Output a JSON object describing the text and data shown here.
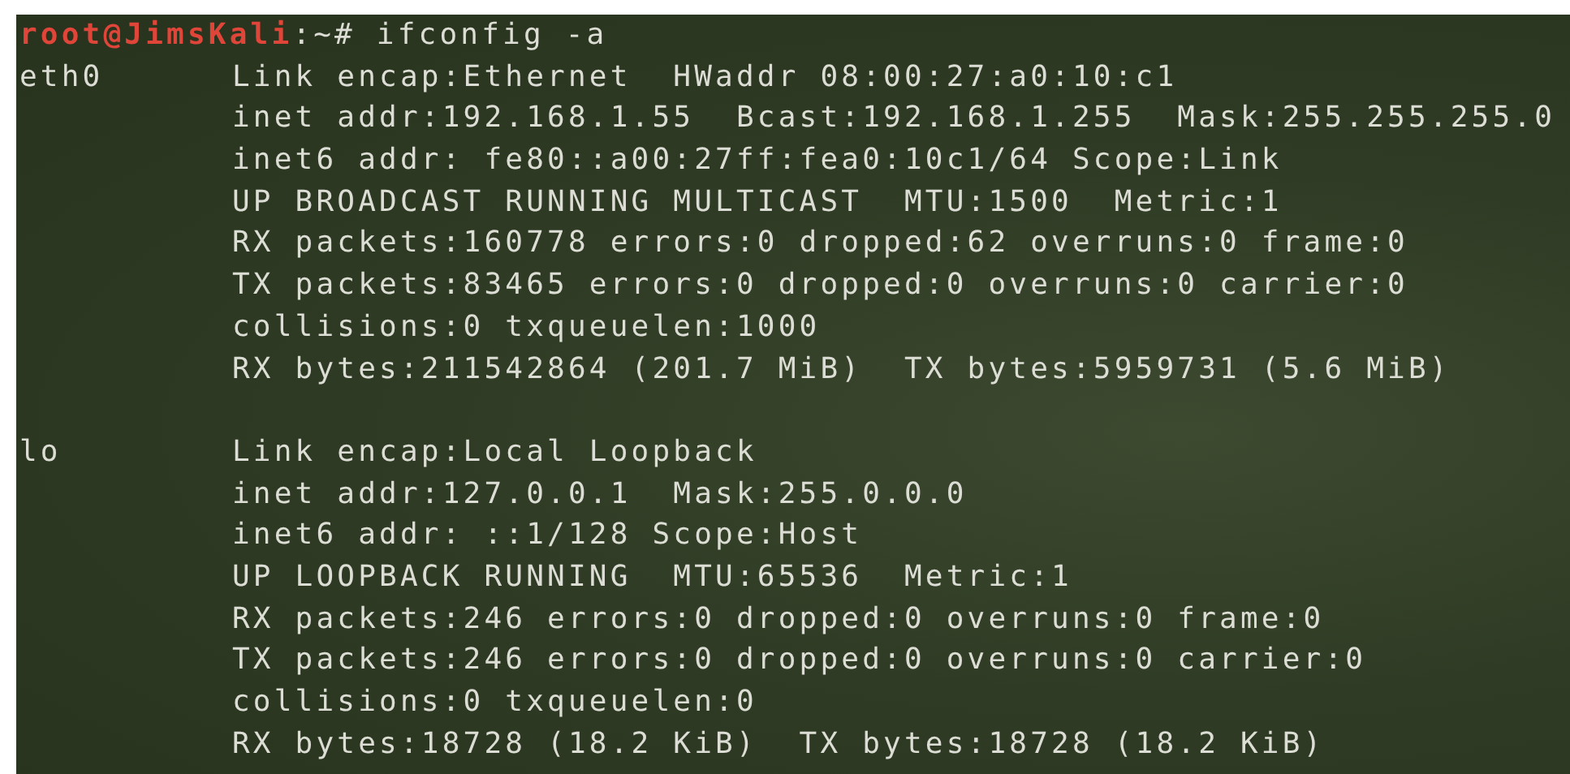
{
  "prompt": {
    "user_host": "root@JimsKali",
    "path": ":~#",
    "command": "ifconfig -a"
  },
  "interfaces": [
    {
      "name": "eth0",
      "lines": [
        "Link encap:Ethernet  HWaddr 08:00:27:a0:10:c1",
        "inet addr:192.168.1.55  Bcast:192.168.1.255  Mask:255.255.255.0",
        "inet6 addr: fe80::a00:27ff:fea0:10c1/64 Scope:Link",
        "UP BROADCAST RUNNING MULTICAST  MTU:1500  Metric:1",
        "RX packets:160778 errors:0 dropped:62 overruns:0 frame:0",
        "TX packets:83465 errors:0 dropped:0 overruns:0 carrier:0",
        "collisions:0 txqueuelen:1000",
        "RX bytes:211542864 (201.7 MiB)  TX bytes:5959731 (5.6 MiB)"
      ]
    },
    {
      "name": "lo",
      "lines": [
        "Link encap:Local Loopback",
        "inet addr:127.0.0.1  Mask:255.0.0.0",
        "inet6 addr: ::1/128 Scope:Host",
        "UP LOOPBACK RUNNING  MTU:65536  Metric:1",
        "RX packets:246 errors:0 dropped:0 overruns:0 frame:0",
        "TX packets:246 errors:0 dropped:0 overruns:0 carrier:0",
        "collisions:0 txqueuelen:0",
        "RX bytes:18728 (18.2 KiB)  TX bytes:18728 (18.2 KiB)"
      ]
    }
  ]
}
